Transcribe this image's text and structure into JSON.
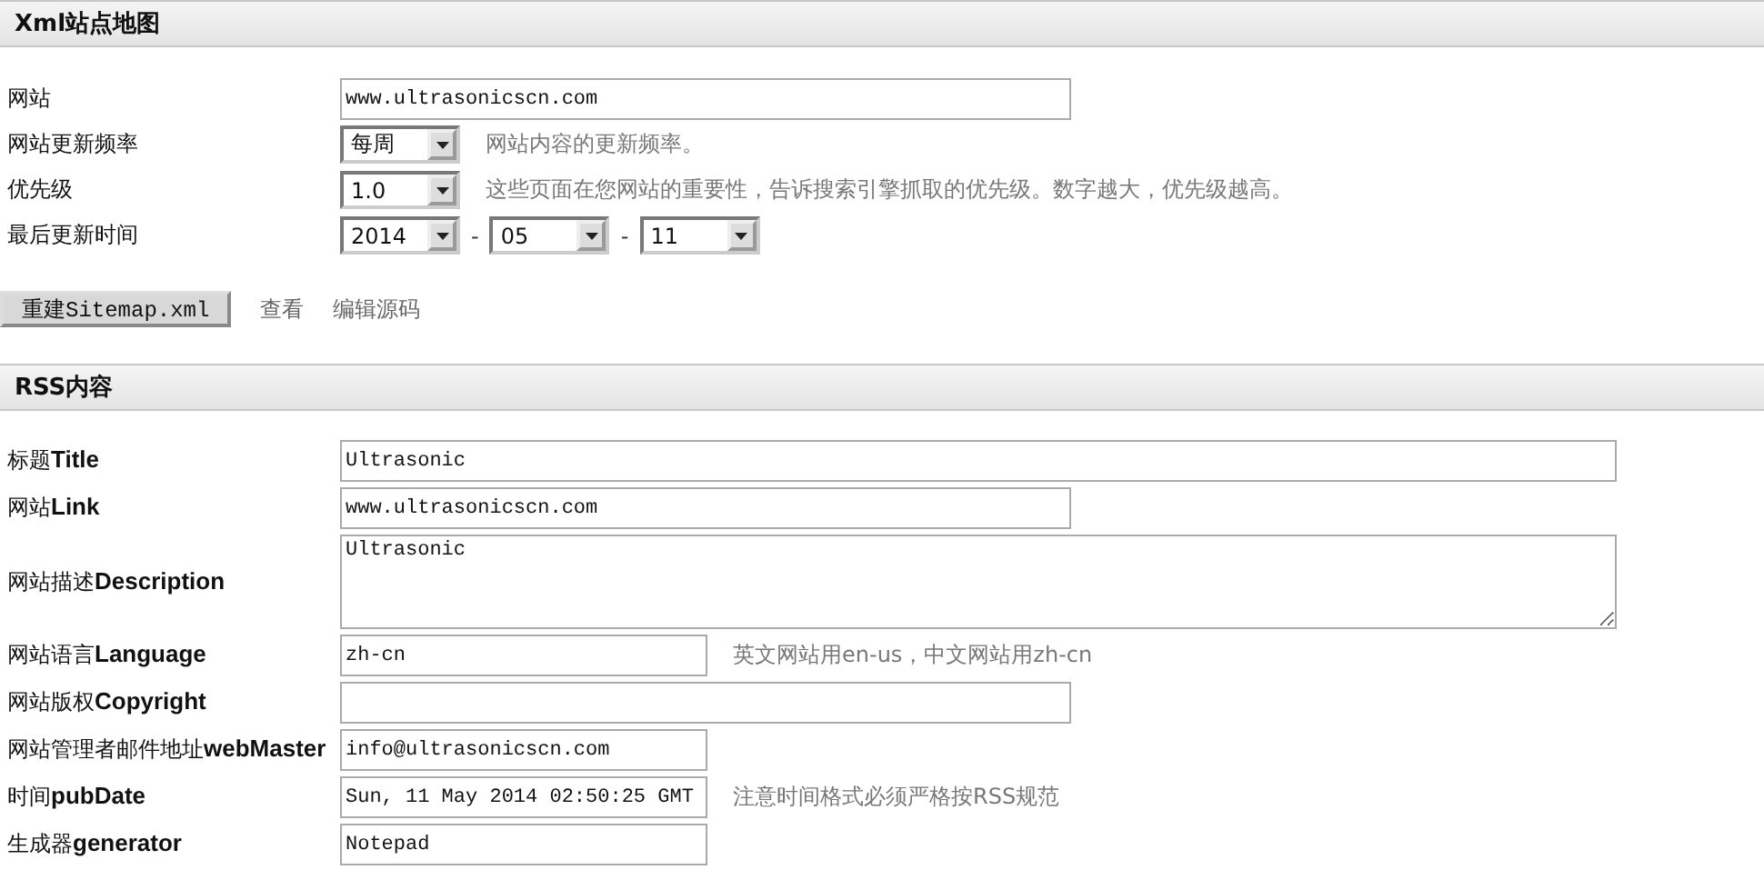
{
  "sitemap": {
    "title": "Xml站点地图",
    "fields": [
      {
        "kind": "text",
        "label": "网站",
        "value": "www.ultrasonicscn.com"
      },
      {
        "kind": "select",
        "label": "网站更新频率",
        "value": "每周",
        "hint": "网站内容的更新频率。"
      },
      {
        "kind": "select",
        "label": "优先级",
        "value": "1.0",
        "hint": "这些页面在您网站的重要性，告诉搜索引擎抓取的优先级。数字越大，优先级越高。"
      },
      {
        "kind": "date",
        "label": "最后更新时间",
        "parts": [
          "2014",
          "05",
          "11"
        ],
        "separators": [
          "-",
          "-"
        ]
      }
    ],
    "actions": {
      "button": "重建Sitemap.xml",
      "links": [
        "查看",
        "编辑源码"
      ]
    }
  },
  "rss": {
    "title": "RSS内容",
    "fields": [
      {
        "kind": "wide",
        "label": "标题**Title**",
        "value": "Ultrasonic"
      },
      {
        "kind": "text",
        "label": "网站**Link**",
        "value": "www.ultrasonicscn.com"
      },
      {
        "kind": "textarea",
        "label": "网站描述**Description**",
        "value": "Ultrasonic"
      },
      {
        "kind": "short",
        "label": "网站语言**Language**",
        "value": "zh-cn",
        "hint": "英文网站用en-us，中文网站用zh-cn"
      },
      {
        "kind": "text",
        "label": "网站版权**Copyright**"
      },
      {
        "kind": "short",
        "label": "网站管理者邮件地址**webMaster**",
        "value": "info@ultrasonicscn.com"
      },
      {
        "kind": "short",
        "label": "时间**pubDate**",
        "value": "Sun, 11 May 2014 02:50:25 GMT",
        "hint": "注意时间格式必须严格按RSS规范"
      },
      {
        "kind": "short",
        "label": "生成器**generator**",
        "value": "Notepad"
      }
    ]
  }
}
